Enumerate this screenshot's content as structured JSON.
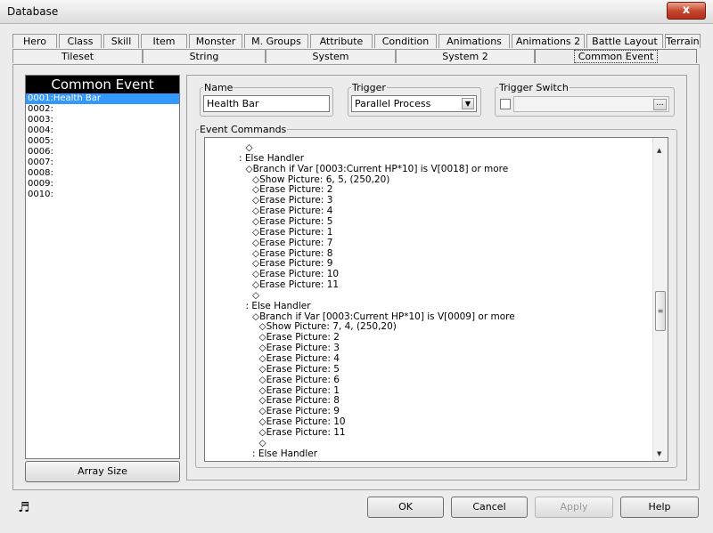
{
  "window": {
    "title": "Database",
    "close_glyph": "x"
  },
  "tabs_row1": [
    "Hero",
    "Class",
    "Skill",
    "Item",
    "Monster",
    "M. Groups",
    "Attribute",
    "Condition",
    "Animations",
    "Animations 2",
    "Battle Layout",
    "Terrain"
  ],
  "tabs_row2": [
    "Tileset",
    "String",
    "System",
    "System 2",
    "Common Event"
  ],
  "active_tab": "Common Event",
  "list": {
    "header": "Common Event",
    "items": [
      "0001:Health Bar",
      "0002:",
      "0003:",
      "0004:",
      "0005:",
      "0006:",
      "0007:",
      "0008:",
      "0009:",
      "0010:"
    ],
    "selected_index": 0
  },
  "array_size_button": "Array Size",
  "name_group": {
    "label": "Name",
    "value": "Health Bar"
  },
  "trigger_group": {
    "label": "Trigger",
    "value": "Parallel Process"
  },
  "trigger_switch_group": {
    "label": "Trigger Switch",
    "checked": false,
    "value": "",
    "browse": "..."
  },
  "event_commands": {
    "label": "Event Commands",
    "lines": [
      {
        "indent": 5,
        "text": "◇"
      },
      {
        "indent": 4,
        "text": ": Else Handler"
      },
      {
        "indent": 5,
        "text": "◇Branch if Var [0003:Current HP*10] is V[0018] or more"
      },
      {
        "indent": 6,
        "text": "◇Show Picture: 6, 5, (250,20)"
      },
      {
        "indent": 6,
        "text": "◇Erase Picture: 2"
      },
      {
        "indent": 6,
        "text": "◇Erase Picture: 3"
      },
      {
        "indent": 6,
        "text": "◇Erase Picture: 4"
      },
      {
        "indent": 6,
        "text": "◇Erase Picture: 5"
      },
      {
        "indent": 6,
        "text": "◇Erase Picture: 1"
      },
      {
        "indent": 6,
        "text": "◇Erase Picture: 7"
      },
      {
        "indent": 6,
        "text": "◇Erase Picture: 8"
      },
      {
        "indent": 6,
        "text": "◇Erase Picture: 9"
      },
      {
        "indent": 6,
        "text": "◇Erase Picture: 10"
      },
      {
        "indent": 6,
        "text": "◇Erase Picture: 11"
      },
      {
        "indent": 6,
        "text": "◇"
      },
      {
        "indent": 5,
        "text": ": Else Handler"
      },
      {
        "indent": 6,
        "text": "◇Branch if Var [0003:Current HP*10] is V[0009] or more"
      },
      {
        "indent": 7,
        "text": "◇Show Picture: 7, 4, (250,20)"
      },
      {
        "indent": 7,
        "text": "◇Erase Picture: 2"
      },
      {
        "indent": 7,
        "text": "◇Erase Picture: 3"
      },
      {
        "indent": 7,
        "text": "◇Erase Picture: 4"
      },
      {
        "indent": 7,
        "text": "◇Erase Picture: 5"
      },
      {
        "indent": 7,
        "text": "◇Erase Picture: 6"
      },
      {
        "indent": 7,
        "text": "◇Erase Picture: 1"
      },
      {
        "indent": 7,
        "text": "◇Erase Picture: 8"
      },
      {
        "indent": 7,
        "text": "◇Erase Picture: 9"
      },
      {
        "indent": 7,
        "text": "◇Erase Picture: 10"
      },
      {
        "indent": 7,
        "text": "◇Erase Picture: 11"
      },
      {
        "indent": 7,
        "text": "◇"
      },
      {
        "indent": 6,
        "text": ": Else Handler"
      }
    ]
  },
  "buttons": {
    "ok": "OK",
    "cancel": "Cancel",
    "apply": "Apply",
    "help": "Help"
  },
  "icons": {
    "status": "music-note-icon"
  }
}
